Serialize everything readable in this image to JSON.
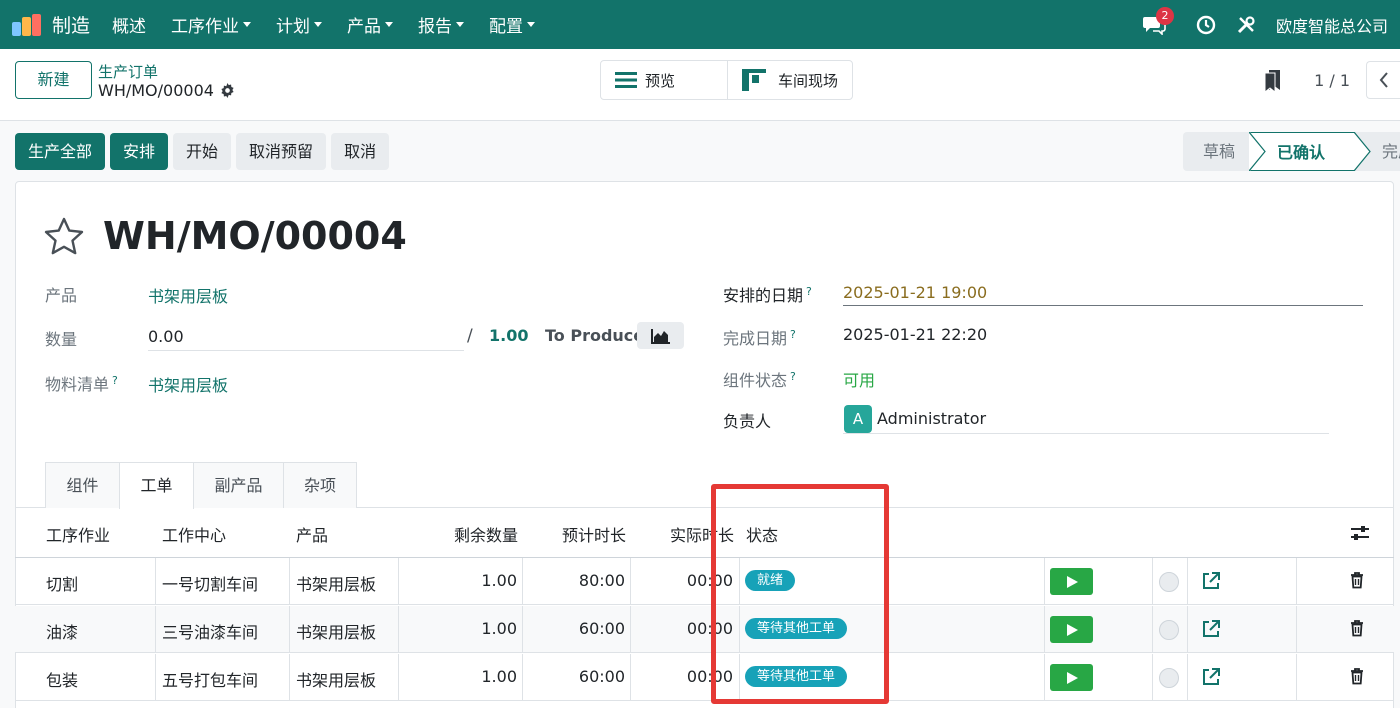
{
  "navbar": {
    "brand": "制造",
    "menu": [
      {
        "label": "概述",
        "dropdown": false
      },
      {
        "label": "工序作业",
        "dropdown": true
      },
      {
        "label": "计划",
        "dropdown": true
      },
      {
        "label": "产品",
        "dropdown": true
      },
      {
        "label": "报告",
        "dropdown": true
      },
      {
        "label": "配置",
        "dropdown": true
      }
    ],
    "messages_count": "2",
    "company": "欧度智能总公司",
    "icons": [
      "chat-icon",
      "clock-icon",
      "tools-icon"
    ]
  },
  "control": {
    "new_label": "新建",
    "breadcrumb_parent": "生产订单",
    "breadcrumb_current": "WH/MO/00004",
    "views": [
      {
        "label": "预览",
        "icon": "list-icon"
      },
      {
        "label": "车间现场",
        "icon": "shopfloor-icon"
      }
    ],
    "pager": "1 / 1"
  },
  "actions": {
    "produce_all": "生产全部",
    "plan": "安排",
    "start": "开始",
    "unreserve": "取消预留",
    "cancel": "取消"
  },
  "statusbar": {
    "stages": [
      "草稿",
      "已确认",
      "完成"
    ],
    "active": "已确认"
  },
  "form": {
    "title": "WH/MO/00004",
    "product_label": "产品",
    "product_value": "书架用层板",
    "qty_label": "数量",
    "qty_value": "0.00",
    "qty_slash": "/",
    "qty_total": "1.00",
    "to_produce": "To Produce",
    "bom_label": "物料清单",
    "bom_help": "?",
    "bom_value": "书架用层板",
    "scheduled_label": "安排的日期",
    "scheduled_help": "?",
    "scheduled_value": "2025-01-21 19:00",
    "end_label": "完成日期",
    "end_help": "?",
    "end_value": "2025-01-21 22:20",
    "component_status_label": "组件状态",
    "component_status_help": "?",
    "component_status_value": "可用",
    "responsible_label": "负责人",
    "responsible_initial": "A",
    "responsible_value": "Administrator"
  },
  "tabs": [
    "组件",
    "工单",
    "副产品",
    "杂项"
  ],
  "active_tab": "工单",
  "table": {
    "headers": [
      "工序作业",
      "工作中心",
      "产品",
      "剩余数量",
      "预计时长",
      "实际时长",
      "状态"
    ],
    "rows": [
      {
        "operation": "切割",
        "workcenter": "一号切割车间",
        "product": "书架用层板",
        "qty": "1.00",
        "expected": "80:00",
        "actual": "00:00",
        "status": "就绪"
      },
      {
        "operation": "油漆",
        "workcenter": "三号油漆车间",
        "product": "书架用层板",
        "qty": "1.00",
        "expected": "60:00",
        "actual": "00:00",
        "status": "等待其他工单"
      },
      {
        "operation": "包装",
        "workcenter": "五号打包车间",
        "product": "书架用层板",
        "qty": "1.00",
        "expected": "60:00",
        "actual": "00:00",
        "status": "等待其他工单"
      }
    ]
  },
  "colors": {
    "brand": "#12736a",
    "status_pill": "#17a2b8",
    "play": "#28a745",
    "highlight": "#e53935"
  }
}
